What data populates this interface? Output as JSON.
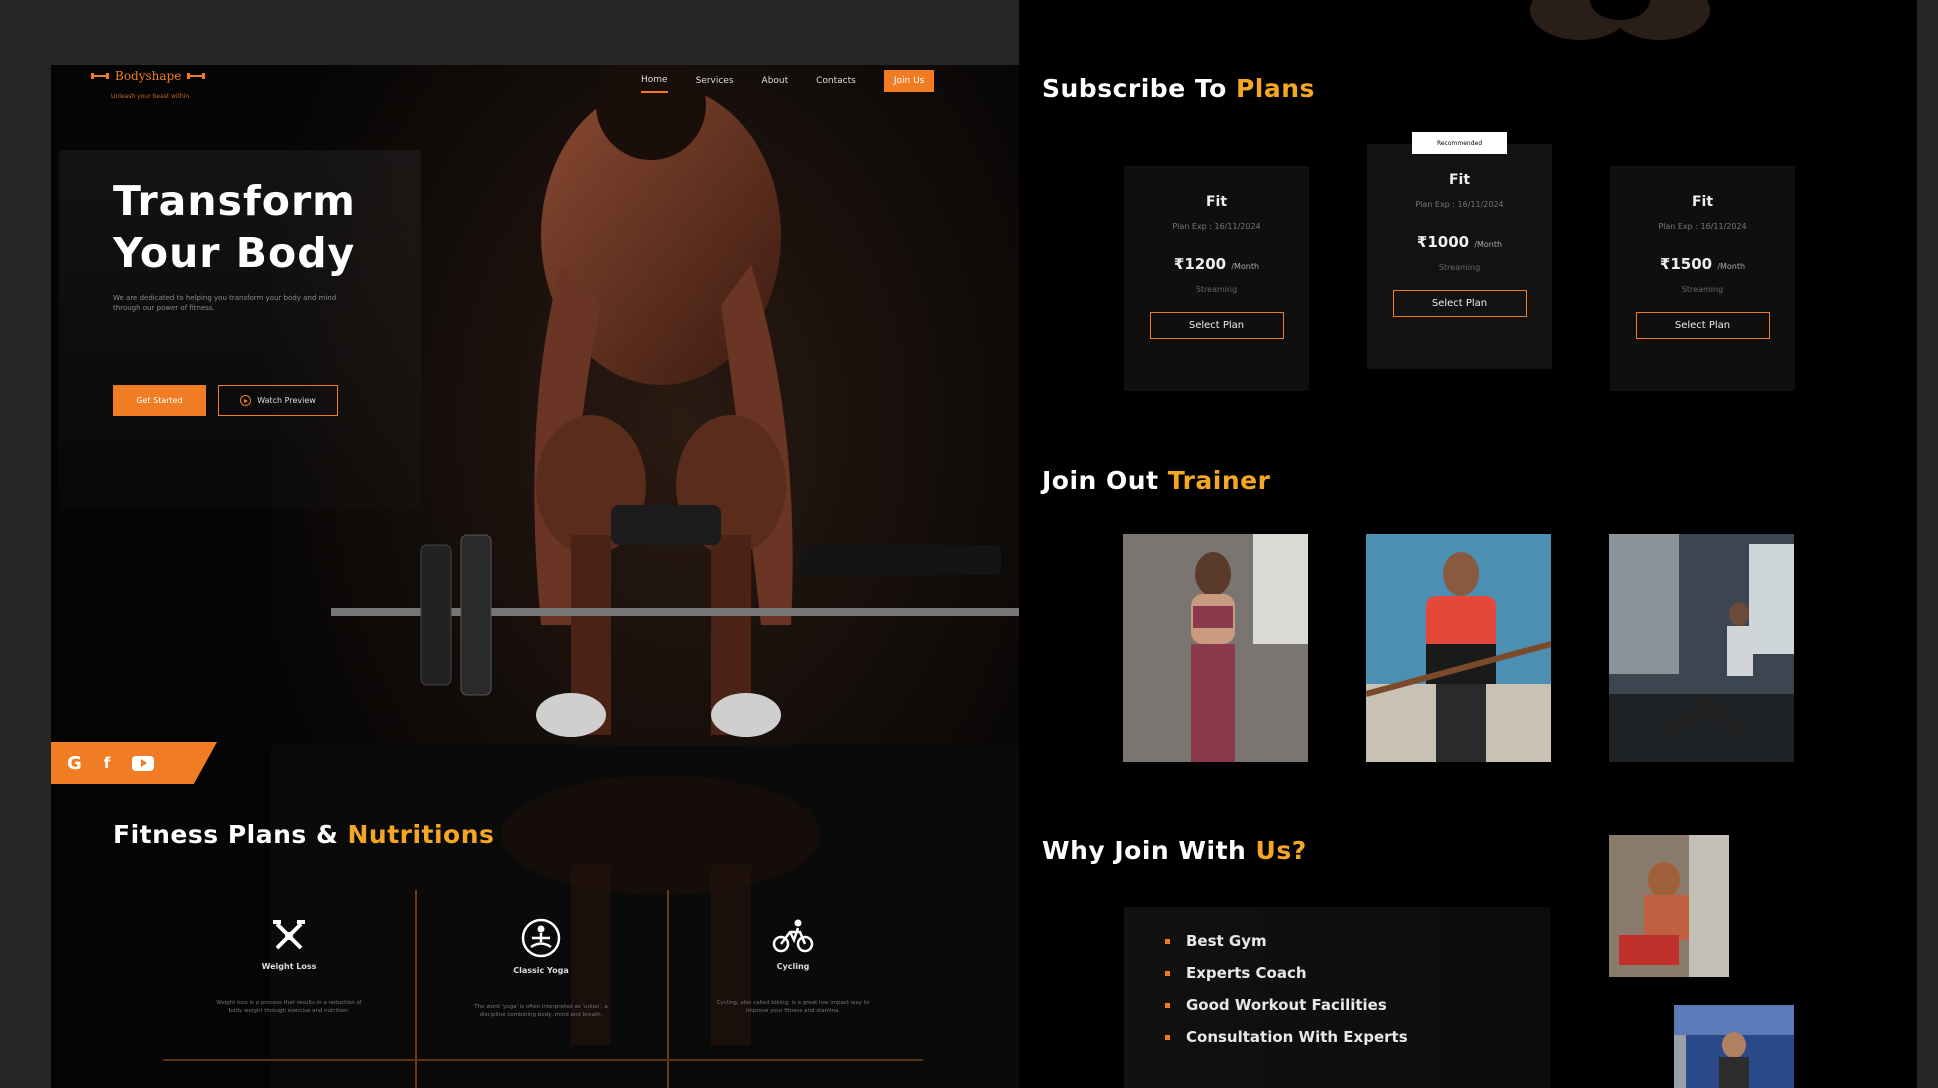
{
  "colors": {
    "accent": "#f07d24",
    "title_accent": "#f5a623",
    "background": "#000000",
    "canvas": "#262626"
  },
  "left": {
    "brand": {
      "name": "Bodyshape",
      "tagline": "Unleash your beast within"
    },
    "nav": {
      "items": [
        "Home",
        "Services",
        "About",
        "Contacts"
      ],
      "active": "Home",
      "cta": "Join Us"
    },
    "hero": {
      "title_line1": "Transform",
      "title_line2": "Your Body",
      "subtitle": "We are dedicated to helping you transform your body and mind through our power of fitness.",
      "primary_button": "Get Started",
      "secondary_button": "Watch Preview"
    },
    "social": [
      "google-icon",
      "facebook-icon",
      "youtube-icon"
    ],
    "fitness": {
      "title": "Fitness Plans & ",
      "title_accent": "Nutritions",
      "items": [
        {
          "icon": "weight-loss-icon",
          "name": "Weight Loss",
          "desc": "Weight loss is a process that results in a reduction of body weight through exercise and nutrition."
        },
        {
          "icon": "yoga-icon",
          "name": "Classic Yoga",
          "desc": "The word 'yoga' is often interpreted as 'union', a discipline combining body, mind and breath."
        },
        {
          "icon": "cycling-icon",
          "name": "Cycling",
          "desc": "Cycling, also called biking, is a great low impact way to improve your fitness and stamina."
        }
      ]
    }
  },
  "right": {
    "plans_title": "Subscribe To ",
    "plans_title_accent": "Plans",
    "recommended_badge": "Recommended",
    "plans": [
      {
        "name": "Fit",
        "exp": "Plan Exp : 16/11/2024",
        "price": "₹1200",
        "per": "/Month",
        "feature": "Streaming",
        "button": "Select Plan"
      },
      {
        "name": "Fit",
        "exp": "Plan Exp : 16/11/2024",
        "price": "₹1000",
        "per": "/Month",
        "feature": "Streaming",
        "button": "Select Plan"
      },
      {
        "name": "Fit",
        "exp": "Plan Exp : 16/11/2024",
        "price": "₹1500",
        "per": "/Month",
        "feature": "Streaming",
        "button": "Select Plan"
      }
    ],
    "trainer_title": "Join Out ",
    "trainer_title_accent": "Trainer",
    "why_title": "Why Join With ",
    "why_title_accent": "Us?",
    "why_items": [
      "Best Gym",
      "Experts Coach",
      "Good Workout Facilities",
      "Consultation With Experts"
    ]
  }
}
